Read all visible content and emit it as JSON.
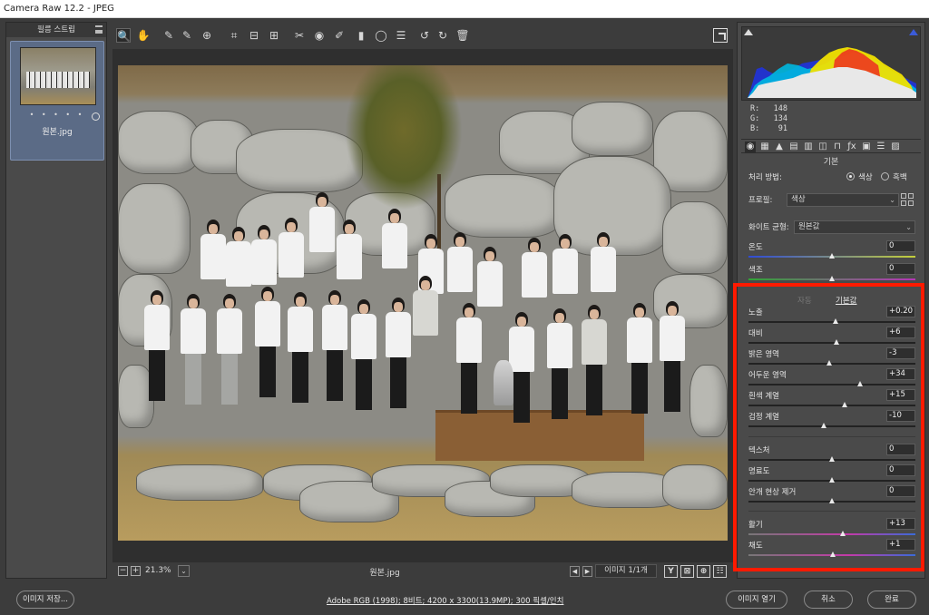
{
  "window": {
    "title": "Camera Raw 12.2  -  JPEG"
  },
  "filmstrip": {
    "title": "필름 스트립",
    "dots": "• • • • •",
    "thumbnail_name": "원본.jpg"
  },
  "toolbar": {
    "tools": [
      {
        "name": "zoom-tool",
        "glyph": "🔍"
      },
      {
        "name": "hand-tool",
        "glyph": "✋"
      },
      {
        "name": "white-balance-tool",
        "glyph": "✎"
      },
      {
        "name": "color-sampler-tool",
        "glyph": "✎"
      },
      {
        "name": "targeted-adjustment-tool",
        "glyph": "⊕"
      },
      {
        "name": "crop-tool",
        "glyph": "⌗"
      },
      {
        "name": "straighten-tool",
        "glyph": "⊟"
      },
      {
        "name": "transform-tool",
        "glyph": "⊞"
      },
      {
        "name": "spot-removal-tool",
        "glyph": "✂"
      },
      {
        "name": "red-eye-tool",
        "glyph": "◉"
      },
      {
        "name": "adjustment-brush-tool",
        "glyph": "✐"
      },
      {
        "name": "graduated-filter-tool",
        "glyph": "▮"
      },
      {
        "name": "radial-filter-tool",
        "glyph": "◯"
      },
      {
        "name": "preferences-tool",
        "glyph": "☰"
      },
      {
        "name": "rotate-ccw-tool",
        "glyph": "↺"
      },
      {
        "name": "rotate-cw-tool",
        "glyph": "↻"
      },
      {
        "name": "trash-tool",
        "glyph": "🗑"
      }
    ]
  },
  "canvas": {
    "zoom": "21.3%",
    "file_name": "원본.jpg",
    "image_count": "이미지 1/1개",
    "view_icons": [
      "Y",
      "⊠",
      "⊕",
      "☷"
    ]
  },
  "histogram": {
    "r": "R:   148",
    "g": "G:   134",
    "b": "B:    91"
  },
  "panel": {
    "section_title": "기본",
    "treatment_label": "처리 방법:",
    "treatment_color": "색상",
    "treatment_bw": "흑백",
    "treatment_selected": "색상",
    "profile_label": "프로필:",
    "profile_value": "색상",
    "wb_label": "화이트 균형:",
    "wb_value": "원본값",
    "temp": {
      "label": "온도",
      "value": "0"
    },
    "tint": {
      "label": "색조",
      "value": "0"
    },
    "auto": "자동",
    "default": "기본값",
    "adjustments": [
      {
        "label": "노출",
        "value": "+0.20"
      },
      {
        "label": "대비",
        "value": "+6"
      },
      {
        "label": "밝은 영역",
        "value": "-3"
      },
      {
        "label": "어두운 영역",
        "value": "+34"
      },
      {
        "label": "흰색 계열",
        "value": "+15"
      },
      {
        "label": "검정 계열",
        "value": "-10"
      },
      {
        "label": "텍스처",
        "value": "0"
      },
      {
        "label": "명료도",
        "value": "0"
      },
      {
        "label": "안개 현상 제거",
        "value": "0"
      },
      {
        "label": "활기",
        "value": "+13"
      },
      {
        "label": "채도",
        "value": "+1"
      }
    ]
  },
  "bottom": {
    "save_image": "이미지 저장...",
    "workflow": "Adobe RGB (1998); 8비트; 4200 x 3300(13.9MP); 300 픽셀/인치",
    "open_image": "이미지 열기",
    "cancel": "취소",
    "done": "완료"
  },
  "colors": {
    "highlight_box": "#ff1a00",
    "background": "#3c3c3c",
    "panel": "#4a4a4a"
  }
}
